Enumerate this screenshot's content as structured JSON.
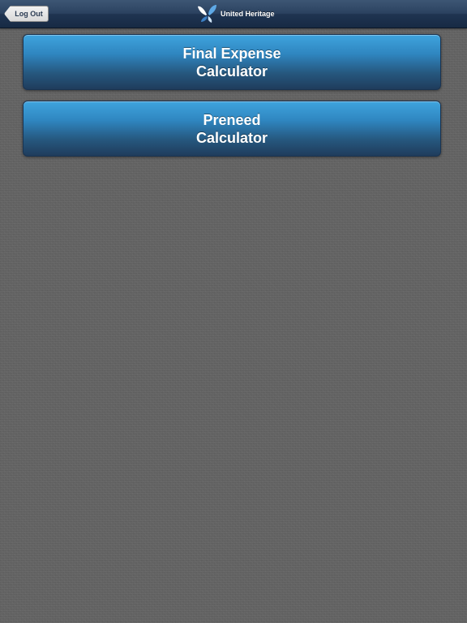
{
  "navbar": {
    "back_label": "Log Out",
    "brand_title": "United Heritage",
    "brand_icon": "butterfly-logo-icon"
  },
  "buttons": [
    {
      "line1": "Final Expense",
      "line2": "Calculator"
    },
    {
      "line1": "Preneed",
      "line2": "Calculator"
    }
  ],
  "colors": {
    "navbar": "#2b4260",
    "button_top": "#3fa4de",
    "button_bottom": "#1f3c5c",
    "background": "#646464"
  }
}
